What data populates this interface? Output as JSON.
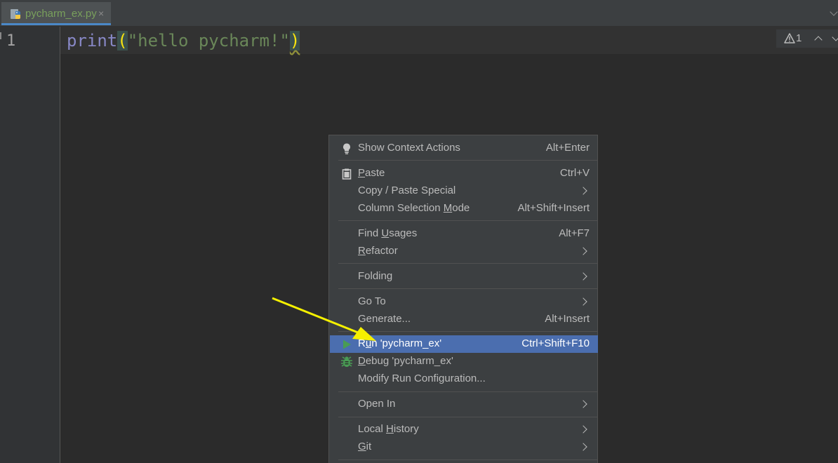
{
  "tab": {
    "filename": "pycharm_ex.py",
    "close": "×",
    "icon": "python-file-icon"
  },
  "gutter": {
    "line_number": "1"
  },
  "code": {
    "keyword": "print",
    "open_paren": "(",
    "string": "\"hello pycharm!\"",
    "close_paren": ")"
  },
  "inspection": {
    "warning_count": "1"
  },
  "menu": {
    "items": [
      {
        "label_pre": "Show Context Actions",
        "label_u": "",
        "label_post": "",
        "shortcut": "Alt+Enter",
        "icon": "lightbulb-icon"
      },
      {
        "label_pre": "",
        "label_u": "P",
        "label_post": "aste",
        "shortcut": "Ctrl+V",
        "icon": "clipboard-icon"
      },
      {
        "label_pre": "Copy / Paste Special",
        "label_u": "",
        "label_post": "",
        "shortcut": "",
        "submenu": true
      },
      {
        "label_pre": "Column Selection ",
        "label_u": "M",
        "label_post": "ode",
        "shortcut": "Alt+Shift+Insert"
      },
      {
        "label_pre": "Find ",
        "label_u": "U",
        "label_post": "sages",
        "shortcut": "Alt+F7"
      },
      {
        "label_pre": "",
        "label_u": "R",
        "label_post": "efactor",
        "shortcut": "",
        "submenu": true
      },
      {
        "label_pre": "Folding",
        "label_u": "",
        "label_post": "",
        "shortcut": "",
        "submenu": true
      },
      {
        "label_pre": "Go To",
        "label_u": "",
        "label_post": "",
        "shortcut": "",
        "submenu": true
      },
      {
        "label_pre": "Generate...",
        "label_u": "",
        "label_post": "",
        "shortcut": "Alt+Insert"
      },
      {
        "label_pre": "R",
        "label_u": "u",
        "label_post": "n 'pycharm_ex'",
        "shortcut": "Ctrl+Shift+F10",
        "icon": "run-icon",
        "selected": true
      },
      {
        "label_pre": "",
        "label_u": "D",
        "label_post": "ebug 'pycharm_ex'",
        "shortcut": "",
        "icon": "debug-bug-icon"
      },
      {
        "label_pre": "Modify Run Configuration...",
        "label_u": "",
        "label_post": "",
        "shortcut": ""
      },
      {
        "label_pre": "Open In",
        "label_u": "",
        "label_post": "",
        "shortcut": "",
        "submenu": true
      },
      {
        "label_pre": "Local ",
        "label_u": "H",
        "label_post": "istory",
        "shortcut": "",
        "submenu": true
      },
      {
        "label_pre": "",
        "label_u": "G",
        "label_post": "it",
        "shortcut": "",
        "submenu": true
      }
    ]
  },
  "colors": {
    "background": "#2b2b2b",
    "menu_bg": "#3c3f41",
    "selection": "#4b6eaf",
    "keyword": "#8888c6",
    "string": "#6a8759",
    "brace_highlight": "#f8e30f",
    "annotation_arrow": "#f5f000",
    "run_green": "#499c54"
  }
}
